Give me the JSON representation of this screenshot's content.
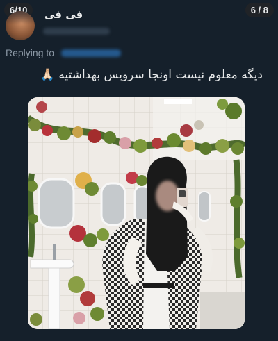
{
  "counters": {
    "left": "6/10",
    "right": "6 / 8"
  },
  "author": {
    "display_name": "فی فی"
  },
  "reply": {
    "prefix": "Replying to"
  },
  "tweet": {
    "text": "دیگه معلوم نیست اونجا سرویس بهداشتیه 🙏🏻"
  },
  "photo": {
    "icon": "tweet-photo"
  }
}
